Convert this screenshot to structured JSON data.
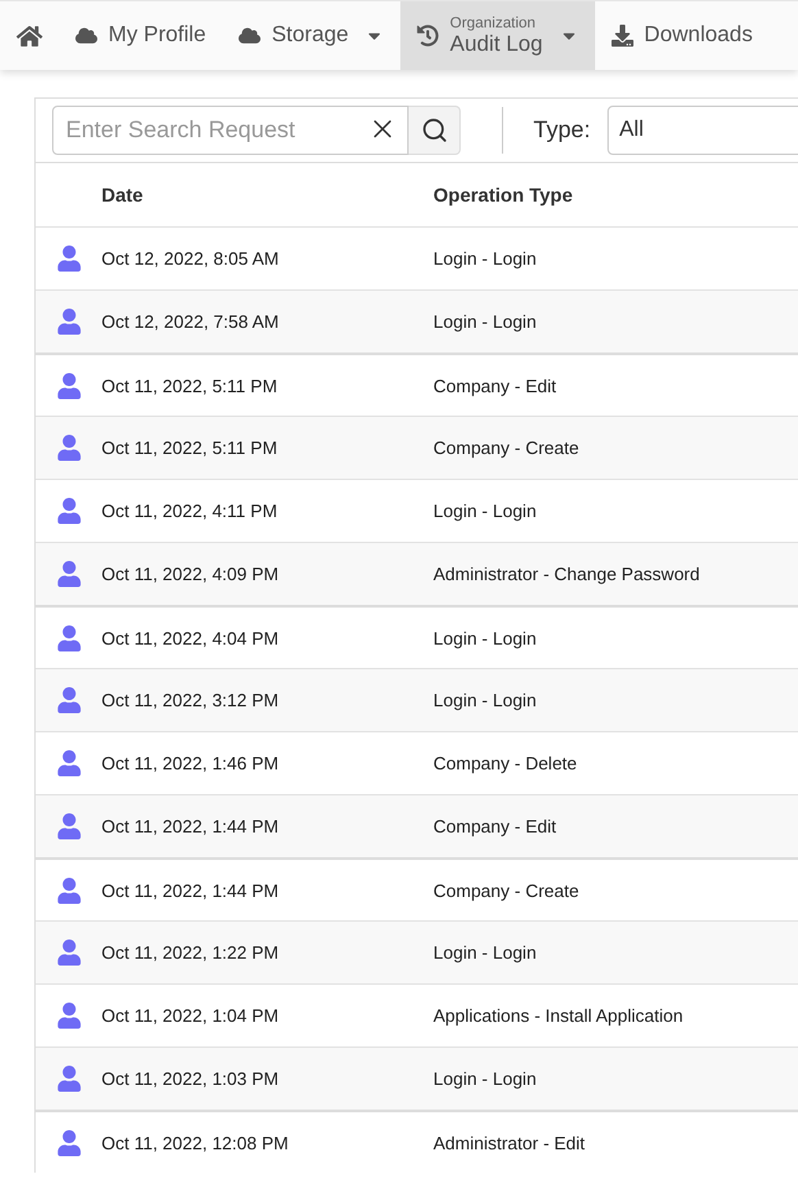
{
  "nav": [
    {
      "kind": "home",
      "selected": false
    },
    {
      "kind": "link",
      "label": "My Profile",
      "selected": false
    },
    {
      "kind": "dropdown",
      "label": "Storage",
      "selected": false
    },
    {
      "kind": "dropdown",
      "subtitle": "Organization",
      "label": "Audit Log",
      "selected": true
    },
    {
      "kind": "link",
      "label": "Downloads",
      "selected": false
    }
  ],
  "toolbar": {
    "search": {
      "placeholder": "Enter Search Request"
    },
    "type_label": "Type:",
    "type_value": "All"
  },
  "table": {
    "columns": [
      "Date",
      "Operation Type"
    ],
    "rows": [
      {
        "date": "Oct 12, 2022, 8:05 AM",
        "operation": "Login - Login"
      },
      {
        "date": "Oct 12, 2022, 7:58 AM",
        "operation": "Login - Login"
      },
      {
        "date": "Oct 11, 2022, 5:11 PM",
        "operation": "Company - Edit"
      },
      {
        "date": "Oct 11, 2022, 5:11 PM",
        "operation": "Company - Create"
      },
      {
        "date": "Oct 11, 2022, 4:11 PM",
        "operation": "Login - Login"
      },
      {
        "date": "Oct 11, 2022, 4:09 PM",
        "operation": "Administrator - Change Password"
      },
      {
        "date": "Oct 11, 2022, 4:04 PM",
        "operation": "Login - Login"
      },
      {
        "date": "Oct 11, 2022, 3:12 PM",
        "operation": "Login - Login"
      },
      {
        "date": "Oct 11, 2022, 1:46 PM",
        "operation": "Company - Delete"
      },
      {
        "date": "Oct 11, 2022, 1:44 PM",
        "operation": "Company - Edit"
      },
      {
        "date": "Oct 11, 2022, 1:44 PM",
        "operation": "Company - Create"
      },
      {
        "date": "Oct 11, 2022, 1:22 PM",
        "operation": "Login - Login"
      },
      {
        "date": "Oct 11, 2022, 1:04 PM",
        "operation": "Applications - Install Application"
      },
      {
        "date": "Oct 11, 2022, 1:03 PM",
        "operation": "Login - Login"
      },
      {
        "date": "Oct 11, 2022, 12:08 PM",
        "operation": "Administrator - Edit"
      }
    ]
  }
}
